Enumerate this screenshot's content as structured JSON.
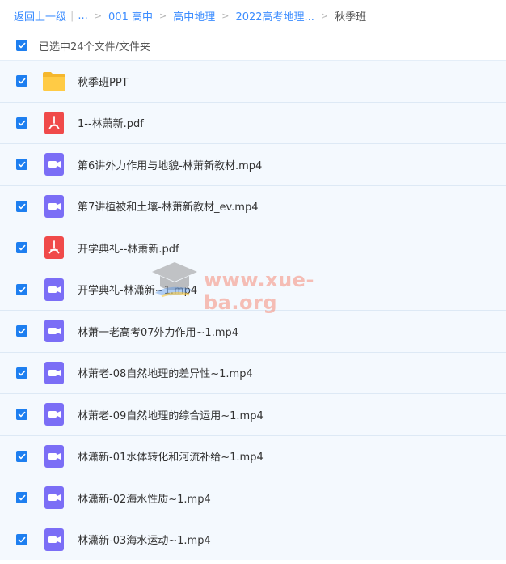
{
  "breadcrumb": {
    "back": "返回上一级",
    "ellipsis": "...",
    "items": [
      "001 高中",
      "高中地理",
      "2022高考地理..."
    ],
    "current": "秋季班"
  },
  "selection": {
    "label": "已选中24个文件/文件夹"
  },
  "files": [
    {
      "name": "秋季班PPT",
      "icon": "folder-icon"
    },
    {
      "name": "1--林萧新.pdf",
      "icon": "pdf-icon"
    },
    {
      "name": "第6讲外力作用与地貌-林萧新教材.mp4",
      "icon": "video-icon"
    },
    {
      "name": "第7讲植被和土壤-林萧新教材_ev.mp4",
      "icon": "video-icon"
    },
    {
      "name": "开学典礼--林萧新.pdf",
      "icon": "pdf-icon"
    },
    {
      "name": "开学典礼-林潇新~1.mp4",
      "icon": "video-icon"
    },
    {
      "name": "林萧一老高考07外力作用~1.mp4",
      "icon": "video-icon"
    },
    {
      "name": "林萧老-08自然地理的差异性~1.mp4",
      "icon": "video-icon"
    },
    {
      "name": "林萧老-09自然地理的综合运用~1.mp4",
      "icon": "video-icon"
    },
    {
      "name": "林潇新-01水体转化和河流补给~1.mp4",
      "icon": "video-icon"
    },
    {
      "name": "林潇新-02海水性质~1.mp4",
      "icon": "video-icon"
    },
    {
      "name": "林潇新-03海水运动~1.mp4",
      "icon": "video-icon"
    }
  ],
  "watermark": {
    "text": "www.xue-ba.org"
  },
  "colors": {
    "accent": "#1e7ff0",
    "link": "#3b8cff",
    "folder": "#ffc637",
    "pdf": "#f04a4a",
    "video": "#7b6ef6",
    "row_bg": "#f4f9fe"
  }
}
